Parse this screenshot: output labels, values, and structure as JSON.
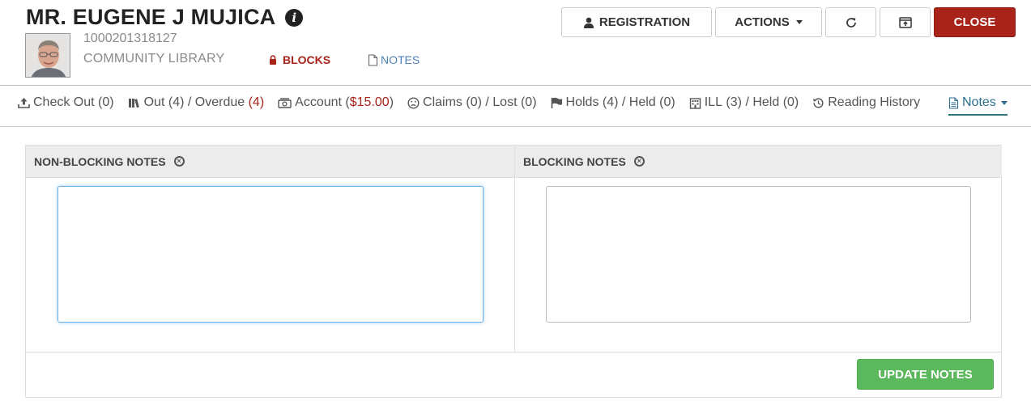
{
  "patron": {
    "name": "MR. EUGENE J MUJICA",
    "id": "1000201318127",
    "library": "COMMUNITY LIBRARY",
    "blocks_label": "BLOCKS",
    "notes_label": "NOTES"
  },
  "header_buttons": {
    "registration": "REGISTRATION",
    "actions": "ACTIONS",
    "close": "CLOSE"
  },
  "nav": {
    "checkout": {
      "label": "Check Out",
      "count": "(0)"
    },
    "out": {
      "label": "Out",
      "count": "(4)",
      "sep": "/ Overdue",
      "overdue": "(4)"
    },
    "account": {
      "label": "Account",
      "open": "(",
      "amount": "$15.00",
      "close": ")"
    },
    "claims": {
      "label": "Claims",
      "count": "(0)",
      "sep": "/ Lost",
      "lost": "(0)"
    },
    "holds": {
      "label": "Holds",
      "count": "(4)",
      "sep": "/ Held",
      "held": "(0)"
    },
    "ill": {
      "label": "ILL",
      "count": "(3)",
      "sep": "/ Held",
      "held": "(0)"
    },
    "history": {
      "label": "Reading History"
    },
    "notes": {
      "label": "Notes"
    }
  },
  "notes_panel": {
    "non_blocking_header": "NON-BLOCKING NOTES",
    "blocking_header": "BLOCKING NOTES",
    "non_blocking_value": "",
    "blocking_value": "",
    "update_button": "UPDATE NOTES"
  },
  "colors": {
    "close_button": "#a8231a",
    "update_button": "#5cb85c",
    "link_blue": "#4d82b8",
    "alert_red": "#a8231a"
  },
  "icons": {
    "info": "info-icon",
    "lock": "lock-icon",
    "document": "document-icon",
    "user": "user-icon",
    "refresh": "refresh-icon",
    "popout": "popout-icon"
  }
}
